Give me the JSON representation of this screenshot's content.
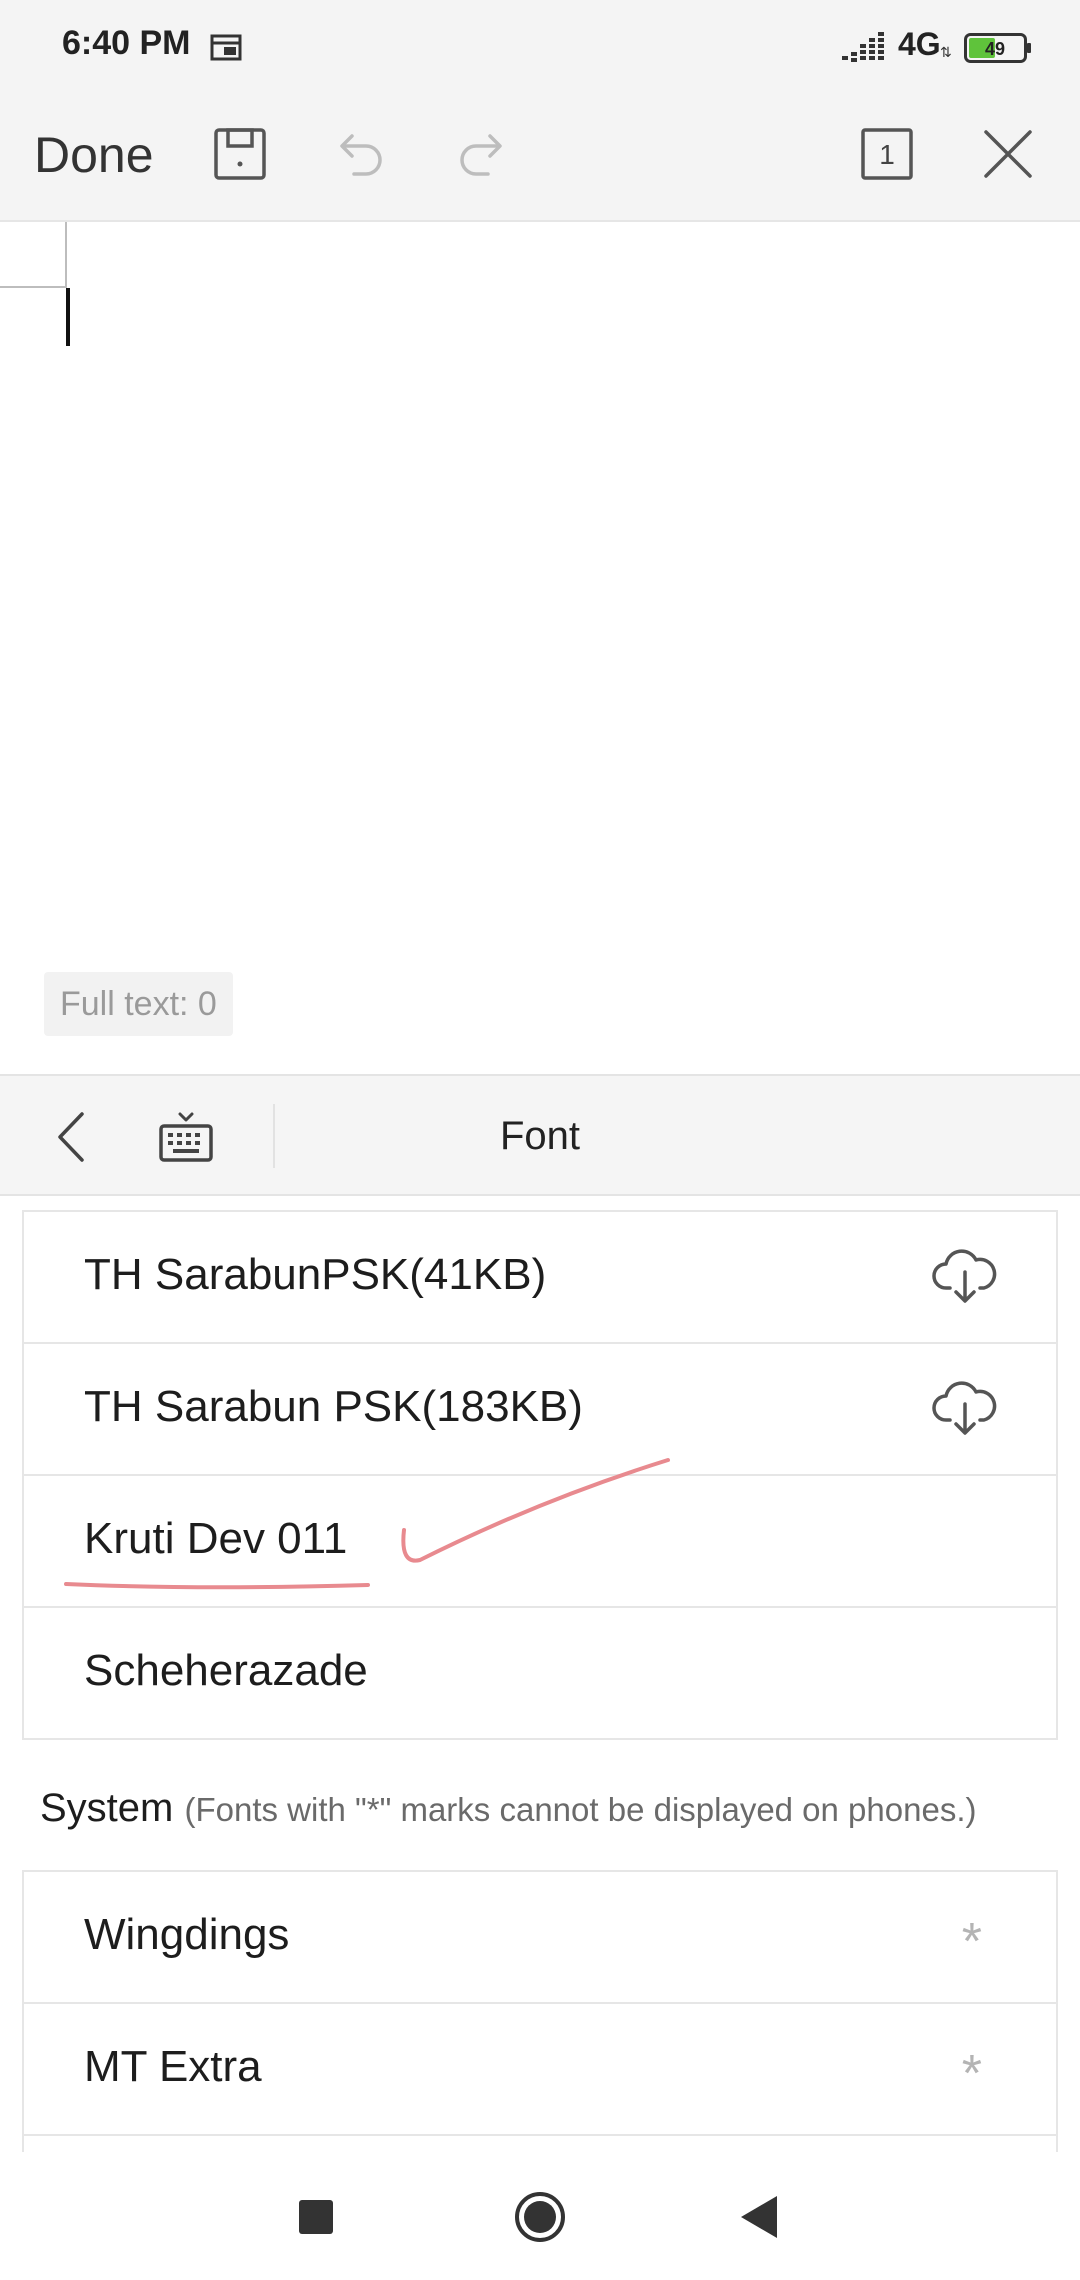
{
  "status_bar": {
    "time": "6:40 PM",
    "network": "4G",
    "battery": "49",
    "battery_level": 0.49,
    "icons": [
      "calendar-icon",
      "signal-icon",
      "battery-icon"
    ]
  },
  "toolbar": {
    "done_label": "Done",
    "page_count": "1",
    "icons": [
      "save-icon",
      "undo-icon",
      "redo-icon",
      "page-icon",
      "close-icon"
    ]
  },
  "document": {
    "full_text_label": "Full text: 0"
  },
  "font_panel": {
    "title": "Font",
    "icons": [
      "back-icon",
      "keyboard-icon"
    ],
    "cloud_fonts": [
      {
        "label": "TH SarabunPSK(41KB)",
        "icon": "cloud-download-icon"
      },
      {
        "label": "TH Sarabun PSK(183KB)",
        "icon": "cloud-download-icon"
      },
      {
        "label": "Kruti Dev 011",
        "icon": ""
      },
      {
        "label": "Scheherazade",
        "icon": ""
      }
    ],
    "system_section": {
      "title": "System",
      "note": "(Fonts with \"*\" marks cannot be displayed on phones.)"
    },
    "system_fonts": [
      {
        "label": "Wingdings",
        "mark": "*"
      },
      {
        "label": "MT Extra",
        "mark": "*"
      }
    ]
  },
  "annotation": {
    "color": "#e88a8f"
  },
  "nav_bar": {
    "icons": [
      "recents-icon",
      "home-icon",
      "back-nav-icon"
    ]
  }
}
